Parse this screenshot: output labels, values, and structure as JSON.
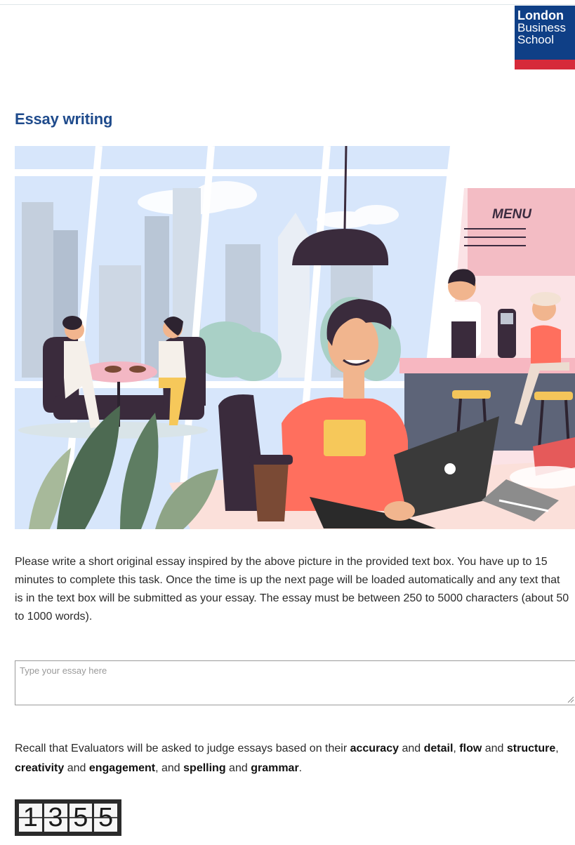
{
  "header": {
    "logo": {
      "line1": "London",
      "line2": "Business",
      "line3": "School"
    }
  },
  "page": {
    "title": "Essay writing"
  },
  "illustration": {
    "menu_sign": "MENU"
  },
  "instructions": "Please write a short original essay inspired by the above picture in the provided text box. You have up to 15 minutes to complete this task. Once the time is up the next page will be loaded automatically and any text that is in the text box will be submitted as your essay. The essay must be between 250 to 5000 characters (about 50 to 1000 words).",
  "essay": {
    "placeholder": "Type your essay here",
    "value": ""
  },
  "recall": {
    "intro": "Recall that Evaluators will be asked to judge essays based on their ",
    "c1": "accuracy",
    "and1": " and ",
    "c2": "detail",
    "sep1": ",",
    "c3": "flow",
    "and2": " and ",
    "c4": "structure",
    "sep2": ", ",
    "c5": "creativity",
    "and3": " and ",
    "c6": "engagement",
    "sep3": ", and ",
    "c7": "spelling",
    "and4": " and ",
    "c8": "grammar",
    "end": "."
  },
  "timer": {
    "d1": "1",
    "d2": "3",
    "d3": "5",
    "d4": "5"
  },
  "colors": {
    "brand_blue": "#0f3f86",
    "brand_red": "#d62a3a",
    "title_blue": "#1f4b8c"
  }
}
